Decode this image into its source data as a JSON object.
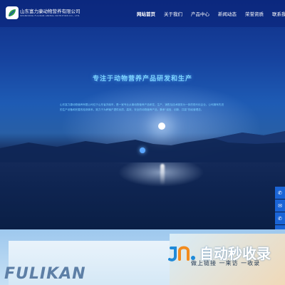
{
  "header": {
    "company_name": "山东富力康动物营养有限公司",
    "company_sub": "SHANDONG FULIKAN ANIMAL NUTRITION CO., LTD.",
    "nav": [
      {
        "label": "网站首页"
      },
      {
        "label": "关于我们"
      },
      {
        "label": "产品中心"
      },
      {
        "label": "新闻动态"
      },
      {
        "label": "荣誉资质"
      },
      {
        "label": "联系我们"
      }
    ]
  },
  "hero": {
    "title": "专注于动物营养产品研发和生产",
    "description": "山东富力康动物营养有限公司位于山东省济南市，是一家专业从事动物营养产品研发、生产、销售及技术服务为一体的现代化企业。公司拥有先进的生产设备和完善的检测体系，致力于为养殖户提供优质、高效、安全的动物营养产品，秉承“诚信、创新、共赢”的经营理念。"
  },
  "sidebar": {
    "buttons": [
      {
        "icon": "phone-icon",
        "glyph": "✆"
      },
      {
        "icon": "mail-icon",
        "glyph": "✉"
      },
      {
        "icon": "phone-icon",
        "glyph": "✆"
      },
      {
        "icon": "chevron-up-icon",
        "glyph": "⌃"
      }
    ]
  },
  "bottom": {
    "brand_text": "FULIKAN",
    "watermark_title": "自动秒收录",
    "watermark_sub": "做上链接 一来访 一收录"
  },
  "colors": {
    "nav_bg": "#0a2378",
    "accent_blue": "#1a64d6",
    "title_cyan": "#7dd3ff"
  }
}
